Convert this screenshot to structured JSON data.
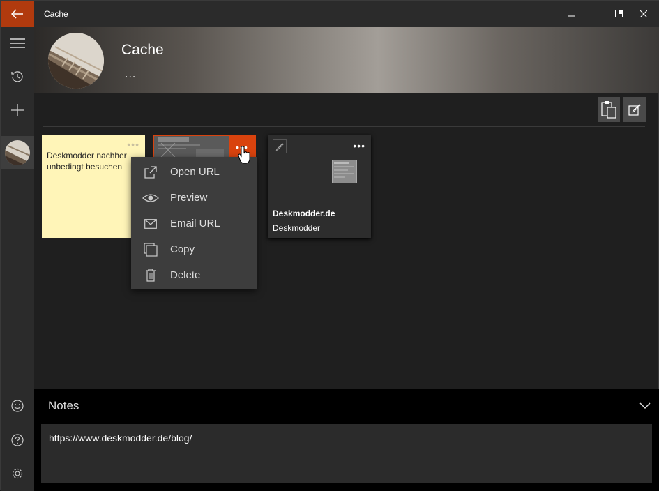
{
  "window": {
    "title": "Cache",
    "accent": "#d9430e"
  },
  "header": {
    "title": "Cache",
    "more_label": "..."
  },
  "rail": {
    "items": [
      {
        "name": "hamburger-menu-icon"
      },
      {
        "name": "history-icon"
      },
      {
        "name": "add-icon"
      },
      {
        "name": "avatar"
      }
    ],
    "bottom": [
      {
        "name": "feedback-smiley-icon"
      },
      {
        "name": "help-icon"
      },
      {
        "name": "settings-gear-icon"
      }
    ]
  },
  "cards": {
    "note": {
      "text": "Deskmodder nachher unbedingt besuchen",
      "dots": "•••"
    },
    "web": {
      "dots": "•••"
    },
    "link": {
      "title": "Deskmodder.de",
      "subtitle": "Deskmodder",
      "dots": "•••"
    }
  },
  "context_menu": {
    "items": [
      {
        "label": "Open URL",
        "icon": "open-url-icon"
      },
      {
        "label": "Preview",
        "icon": "eye-icon"
      },
      {
        "label": "Email URL",
        "icon": "mail-icon"
      },
      {
        "label": "Copy",
        "icon": "copy-icon"
      },
      {
        "label": "Delete",
        "icon": "trash-icon"
      }
    ]
  },
  "notes": {
    "title": "Notes",
    "content": "https://www.deskmodder.de/blog/"
  }
}
